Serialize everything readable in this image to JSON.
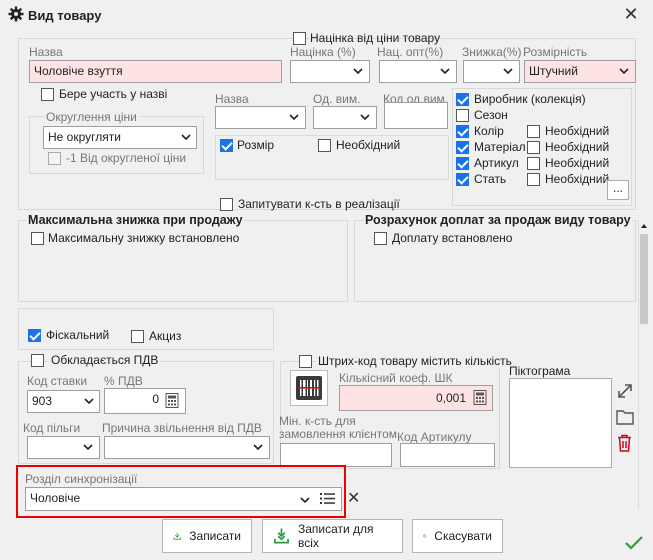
{
  "window": {
    "title": "Вид товару",
    "close": "✕"
  },
  "top": {
    "markup_from_price_label": "Націнка від ціни товару",
    "name_label": "Назва",
    "name_value": "Чоловіче взуття",
    "markup_label": "Націнка (%)",
    "opt_markup_label": "Нац. опт(%)",
    "discount_label": "Знижка(%)",
    "size_grid_label": "Розмірність",
    "size_grid_value": "Штучний",
    "participates_label": "Бере участь у назві",
    "rounding_label": "Округлення ціни",
    "rounding_value": "Не округляти",
    "minus_one_label": "-1 Від округленої ціни",
    "sub_name_label": "Назва",
    "unit_label": "Од. вим.",
    "unit_code_label": "Код од.вим.",
    "size_label": "Розмір",
    "required_label": "Необхідний",
    "ask_qty_label": "Запитувати к-сть в реалізації"
  },
  "attributes": {
    "items": [
      {
        "label": "Виробник (колекція)",
        "checked": true
      },
      {
        "label": "Сезон",
        "checked": false
      },
      {
        "label": "Колір",
        "checked": true
      },
      {
        "label": "Матеріал",
        "checked": true
      },
      {
        "label": "Артикул",
        "checked": true
      },
      {
        "label": "Стать",
        "checked": true
      }
    ],
    "required_label": "Необхідний",
    "more_button": "..."
  },
  "discount_section": {
    "title": "Максимальна знижка при продажу",
    "checkbox_label": "Максимальну знижку встановлено"
  },
  "surcharge_section": {
    "title": "Розрахунок доплат за продаж виду товару",
    "checkbox_label": "Доплату встановлено"
  },
  "fiscal": {
    "fiscal_label": "Фіскальний",
    "excise_label": "Акциз"
  },
  "vat": {
    "taxed_label": "Обкладається ПДВ",
    "rate_code_label": "Код ставки",
    "rate_code_value": "903",
    "vat_percent_label": "% ПДВ",
    "vat_percent_value": "0",
    "benefit_code_label": "Код пільги",
    "exemption_reason_label": "Причина звільнення від ПДВ"
  },
  "barcode": {
    "contains_qty_label": "Штрих-код товару містить кількість",
    "coef_label": "Кількісний коеф. ШК",
    "coef_value": "0,001",
    "min_qty_label": "Мін. к-сть для замовлення клієнтом",
    "article_code_label": "Код Артикулу"
  },
  "pictogram": {
    "label": "Піктограма"
  },
  "sync": {
    "label": "Розділ синхронізації",
    "value": "Чоловіче",
    "clear": "✕"
  },
  "buttons": {
    "save": "Записати",
    "save_all": "Записати для всіх",
    "cancel": "Скасувати"
  },
  "colors": {
    "accent": "#1a73e8",
    "pink": "#fde3e3",
    "highlight": "#e00000",
    "save_green": "#2e9a3e",
    "cancel_red": "#d0021b"
  }
}
